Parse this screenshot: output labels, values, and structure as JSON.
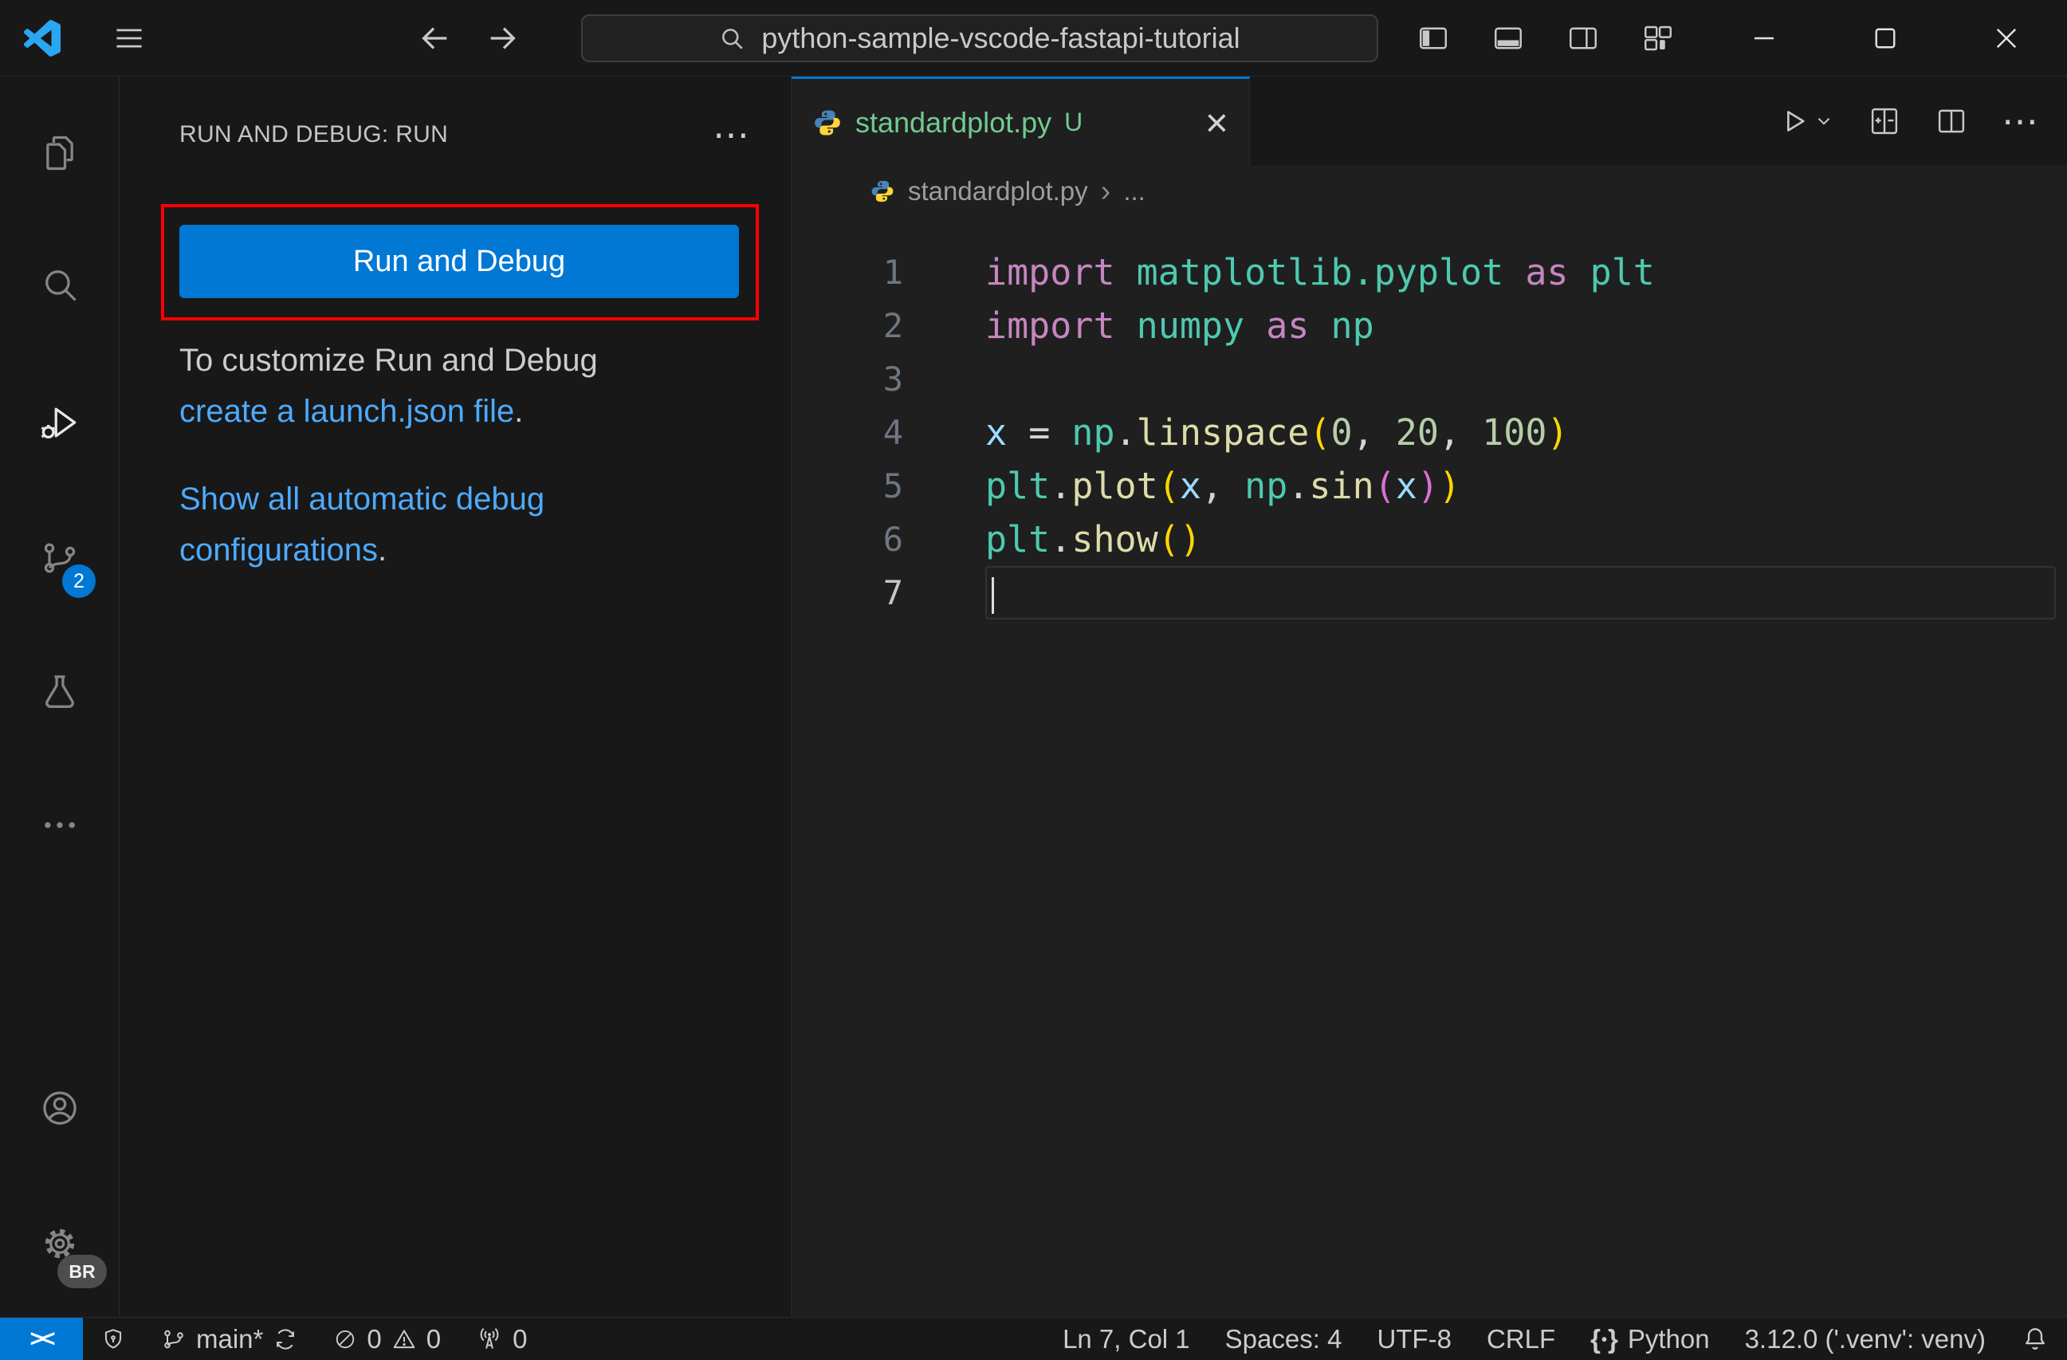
{
  "colors": {
    "accent": "#0078d4",
    "link": "#4daafc",
    "untracked": "#73C991",
    "annotation": "#ff0000",
    "profile_badge_bg": "#4d4d4d",
    "brand_logo": "#2aa7f2",
    "python_blue": "#4584b6",
    "python_yellow": "#ffd43b"
  },
  "title_bar": {
    "search_value": "python-sample-vscode-fastapi-tutorial"
  },
  "activity_bar": {
    "scm_badge": "2",
    "profile_badge": "BR"
  },
  "sidebar": {
    "header": "RUN AND DEBUG: RUN",
    "run_button": "Run and Debug",
    "note_line1": "To customize Run and Debug",
    "note_link": "create a launch.json file",
    "note_suffix": ".",
    "show_all_link": "Show all automatic debug configurations",
    "show_all_suffix": "."
  },
  "editor": {
    "tab_name": "standardplot.py",
    "tab_git_status": "U",
    "breadcrumb_file": "standardplot.py",
    "breadcrumb_more": "...",
    "active_line": 7,
    "code": {
      "token_colors": {
        "kw": "#C586C0",
        "mod": "#4EC9B0",
        "var": "#9CDCFE",
        "fn": "#DCDCAA",
        "num": "#B5CEA8",
        "fg": "#D4D4D4",
        "p1": "#FFD700",
        "p2": "#DA70D6"
      },
      "lines": [
        {
          "num": 1,
          "tokens": [
            {
              "t": "import",
              "c": "kw"
            },
            {
              "t": " ",
              "c": "fg"
            },
            {
              "t": "matplotlib.pyplot",
              "c": "mod"
            },
            {
              "t": " ",
              "c": "fg"
            },
            {
              "t": "as",
              "c": "kw"
            },
            {
              "t": " ",
              "c": "fg"
            },
            {
              "t": "plt",
              "c": "mod"
            }
          ]
        },
        {
          "num": 2,
          "tokens": [
            {
              "t": "import",
              "c": "kw"
            },
            {
              "t": " ",
              "c": "fg"
            },
            {
              "t": "numpy",
              "c": "mod"
            },
            {
              "t": " ",
              "c": "fg"
            },
            {
              "t": "as",
              "c": "kw"
            },
            {
              "t": " ",
              "c": "fg"
            },
            {
              "t": "np",
              "c": "mod"
            }
          ]
        },
        {
          "num": 3,
          "tokens": []
        },
        {
          "num": 4,
          "tokens": [
            {
              "t": "x",
              "c": "var"
            },
            {
              "t": " ",
              "c": "fg"
            },
            {
              "t": "=",
              "c": "fg"
            },
            {
              "t": " ",
              "c": "fg"
            },
            {
              "t": "np",
              "c": "mod"
            },
            {
              "t": ".",
              "c": "fg"
            },
            {
              "t": "linspace",
              "c": "fn"
            },
            {
              "t": "(",
              "c": "p1"
            },
            {
              "t": "0",
              "c": "num"
            },
            {
              "t": ", ",
              "c": "fg"
            },
            {
              "t": "20",
              "c": "num"
            },
            {
              "t": ", ",
              "c": "fg"
            },
            {
              "t": "100",
              "c": "num"
            },
            {
              "t": ")",
              "c": "p1"
            }
          ]
        },
        {
          "num": 5,
          "tokens": [
            {
              "t": "plt",
              "c": "mod"
            },
            {
              "t": ".",
              "c": "fg"
            },
            {
              "t": "plot",
              "c": "fn"
            },
            {
              "t": "(",
              "c": "p1"
            },
            {
              "t": "x",
              "c": "var"
            },
            {
              "t": ", ",
              "c": "fg"
            },
            {
              "t": "np",
              "c": "mod"
            },
            {
              "t": ".",
              "c": "fg"
            },
            {
              "t": "sin",
              "c": "fn"
            },
            {
              "t": "(",
              "c": "p2"
            },
            {
              "t": "x",
              "c": "var"
            },
            {
              "t": ")",
              "c": "p2"
            },
            {
              "t": ")",
              "c": "p1"
            }
          ]
        },
        {
          "num": 6,
          "tokens": [
            {
              "t": "plt",
              "c": "mod"
            },
            {
              "t": ".",
              "c": "fg"
            },
            {
              "t": "show",
              "c": "fn"
            },
            {
              "t": "(",
              "c": "p1"
            },
            {
              "t": ")",
              "c": "p1"
            }
          ]
        },
        {
          "num": 7,
          "tokens": []
        }
      ]
    }
  },
  "status_bar": {
    "remote_glyph": "><",
    "branch": "main*",
    "errors": "0",
    "warnings": "0",
    "ports": "0",
    "cursor_position": "Ln 7, Col 1",
    "indentation": "Spaces: 4",
    "encoding": "UTF-8",
    "eol": "CRLF",
    "language": "Python",
    "interpreter": "3.12.0 ('.venv': venv)"
  },
  "icons": {
    "more": "⋯",
    "close": "×",
    "breadcrumb_chevron": "›",
    "brace_l": "{",
    "brace_r": "}",
    "dot": "•"
  }
}
